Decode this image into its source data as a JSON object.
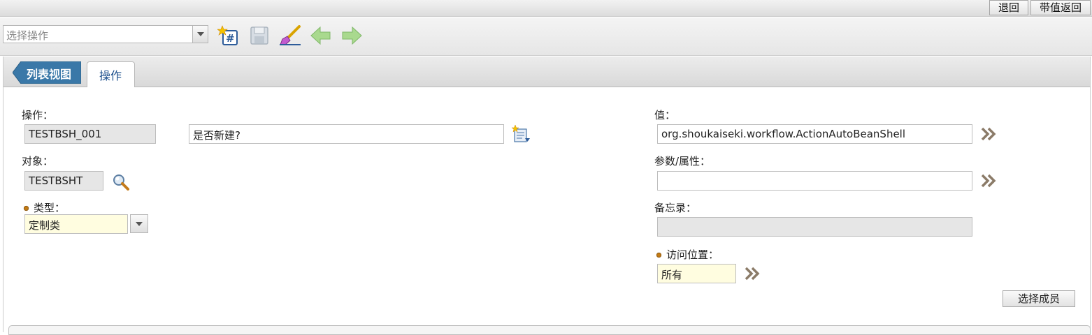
{
  "topbar": {
    "return_label": "退回",
    "return_value_label": "带值返回"
  },
  "toolbar": {
    "select_placeholder": "选择操作",
    "icons": [
      "new-record-icon",
      "save-icon",
      "clear-icon",
      "prev-icon",
      "next-icon"
    ]
  },
  "tabs": {
    "list_view": "列表视图",
    "operation": "操作"
  },
  "form": {
    "operation_label": "操作：",
    "operation_value": "TESTBSH_001",
    "description_value": "是否新建?",
    "object_label": "对象：",
    "object_value": "TESTBSHT",
    "type_label": "类型：",
    "type_value": "定制类",
    "value_label": "值：",
    "value_value": "org.shoukaiseki.workflow.ActionAutoBeanShell",
    "params_label": "参数/属性：",
    "params_value": "",
    "memo_label": "备忘录：",
    "memo_value": "",
    "access_label": "访问位置：",
    "access_value": "所有",
    "select_member_label": "选择成员"
  },
  "colors": {
    "tab_active_text": "#1c4f8c",
    "list_tab_bg": "#3a78a8",
    "required_field_bg": "#fffde0",
    "readonly_field_bg": "#e6e6e6"
  }
}
